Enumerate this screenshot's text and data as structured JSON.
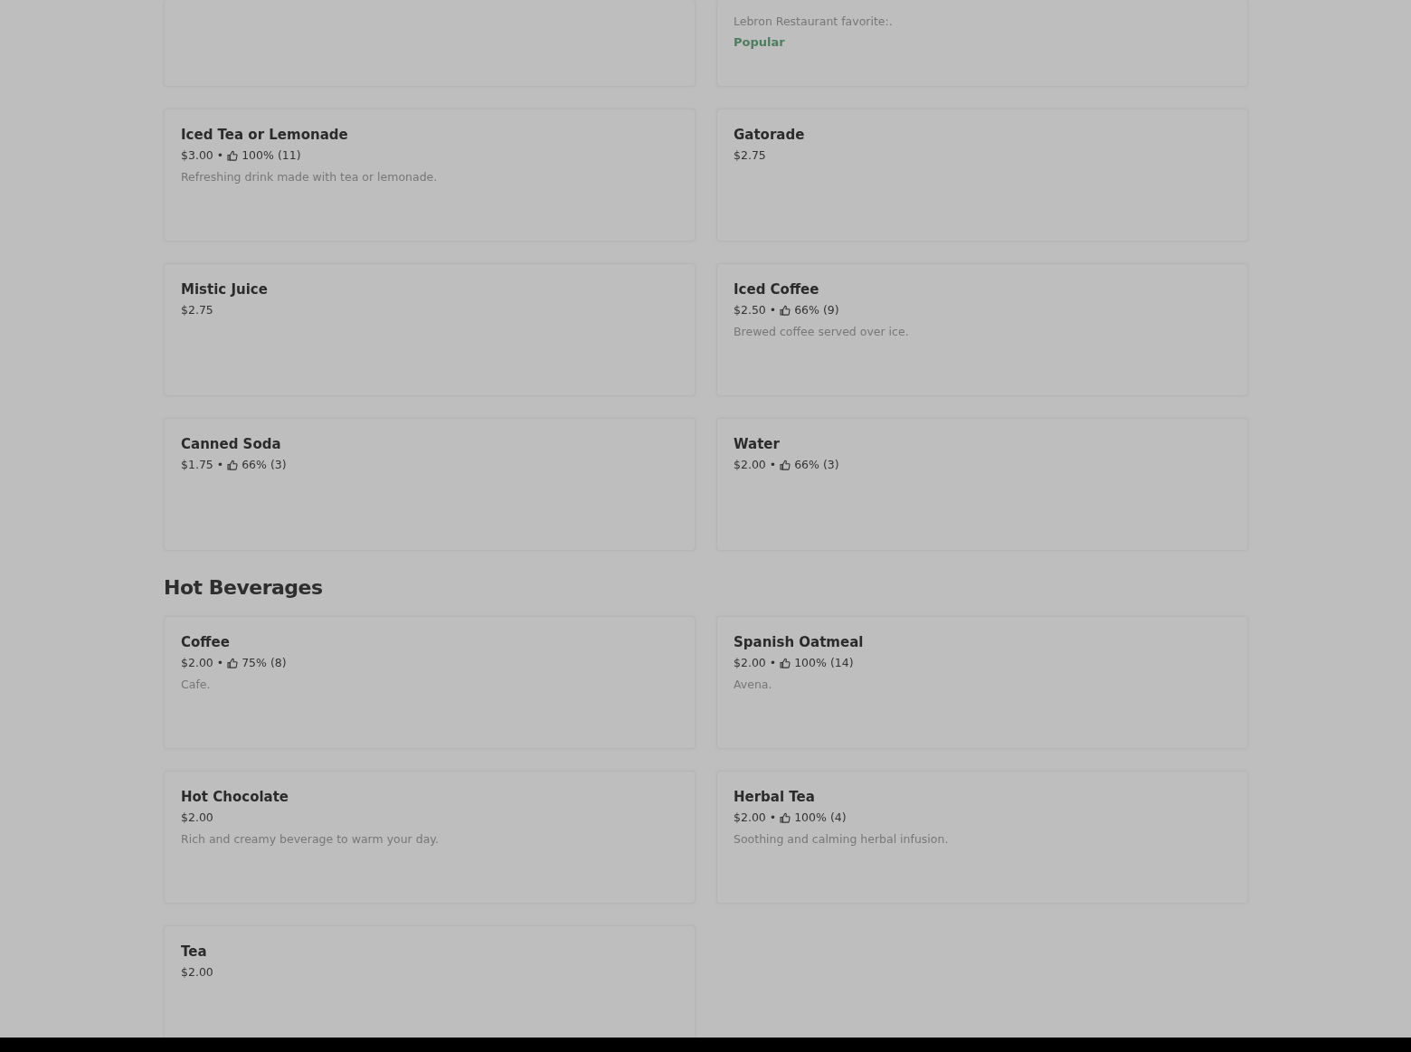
{
  "separator": "•",
  "sections": [
    {
      "items": [
        {
          "kind": "blank"
        },
        {
          "kind": "item",
          "description": "Lebron Restaurant favorite:.",
          "badge": "Popular"
        }
      ]
    },
    {
      "items": [
        {
          "name": "Iced Tea or Lemonade",
          "price": "$3.00",
          "rating": "100% (11)",
          "description": "Refreshing drink made with tea or lemonade."
        },
        {
          "name": "Gatorade",
          "price": "$2.75"
        },
        {
          "name": "Mistic Juice",
          "price": "$2.75"
        },
        {
          "name": "Iced Coffee",
          "price": "$2.50",
          "rating": "66% (9)",
          "description": "Brewed coffee served over ice."
        },
        {
          "name": "Canned Soda",
          "price": "$1.75",
          "rating": "66% (3)"
        },
        {
          "name": "Water",
          "price": "$2.00",
          "rating": "66% (3)"
        }
      ]
    },
    {
      "title": "Hot Beverages",
      "items": [
        {
          "name": "Coffee",
          "price": "$2.00",
          "rating": "75% (8)",
          "description": "Cafe."
        },
        {
          "name": "Spanish Oatmeal",
          "price": "$2.00",
          "rating": "100% (14)",
          "description": "Avena."
        },
        {
          "name": "Hot Chocolate",
          "price": "$2.00",
          "description": "Rich and creamy beverage to warm your day."
        },
        {
          "name": "Herbal Tea",
          "price": "$2.00",
          "rating": "100% (4)",
          "description": "Soothing and calming herbal infusion."
        },
        {
          "name": "Tea",
          "price": "$2.00"
        }
      ]
    }
  ]
}
